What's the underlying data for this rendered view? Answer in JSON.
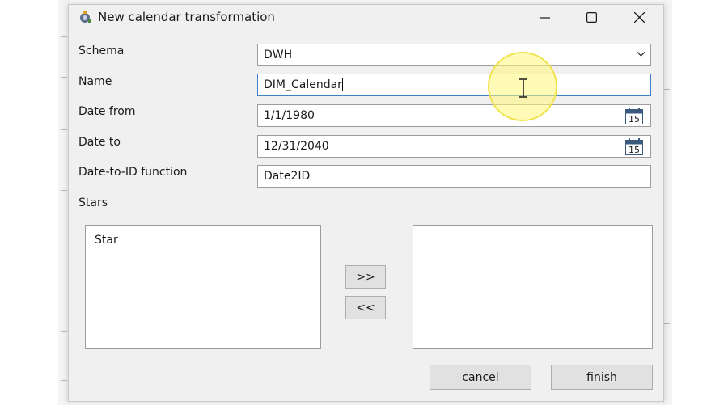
{
  "window": {
    "title": "New calendar transformation",
    "controls": {
      "minimize_icon": "minimize-icon",
      "maximize_icon": "maximize-icon",
      "close_icon": "close-icon"
    }
  },
  "form": {
    "schema": {
      "label": "Schema",
      "value": "DWH"
    },
    "name": {
      "label": "Name",
      "value": "DIM_Calendar"
    },
    "date_from": {
      "label": "Date from",
      "value": "1/1/1980"
    },
    "date_to": {
      "label": "Date to",
      "value": "12/31/2040"
    },
    "date_to_id": {
      "label": "Date-to-ID function",
      "value": "Date2ID"
    },
    "stars_label": "Stars",
    "calendar_icon_text": "15"
  },
  "stars": {
    "available": [
      "Star"
    ],
    "selected": [],
    "add_label": ">>",
    "remove_label": "<<"
  },
  "buttons": {
    "cancel": "cancel",
    "finish": "finish"
  },
  "colors": {
    "focus_border": "#3e80c8",
    "cursor_highlight": "#fff578"
  }
}
